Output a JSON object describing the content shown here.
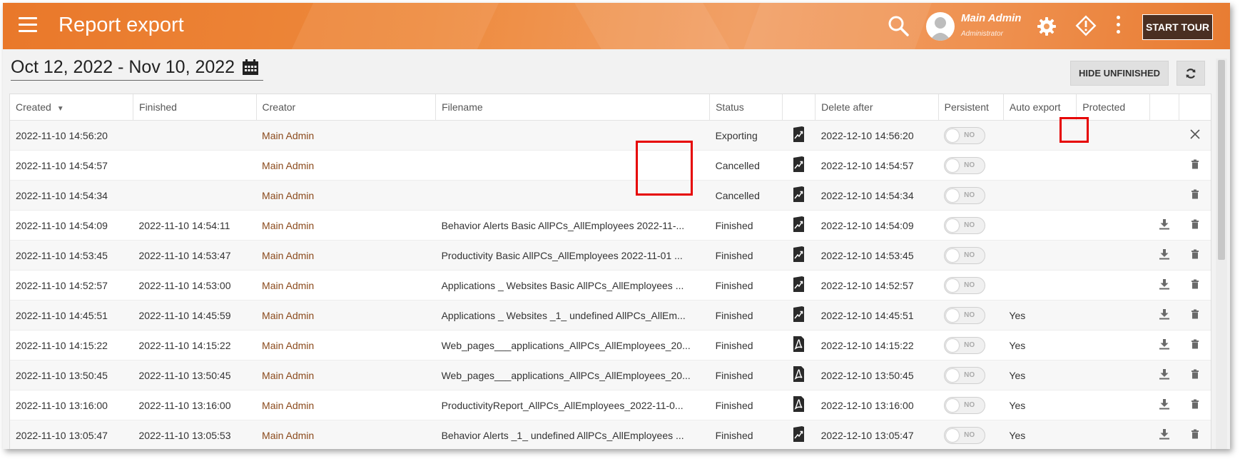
{
  "header": {
    "title": "Report export",
    "user_name": "Main Admin",
    "user_role": "Administrator",
    "start_tour_label": "START TOUR"
  },
  "toolbar": {
    "date_range": "Oct 12, 2022 - Nov 10, 2022",
    "hide_unfinished_label": "HIDE UNFINISHED"
  },
  "table": {
    "columns": [
      "Created",
      "Finished",
      "Creator",
      "Filename",
      "Status",
      "",
      "Delete after",
      "Persistent",
      "Auto export",
      "Protected",
      "",
      ""
    ],
    "toggle_label": "NO",
    "rows": [
      {
        "created": "2022-11-10 14:56:20",
        "finished": "",
        "creator": "Main Admin",
        "filename": "",
        "status": "Exporting",
        "filetype": "chart-icon",
        "delete_after": "2022-12-10 14:56:20",
        "auto_export": "",
        "action": "close-icon"
      },
      {
        "created": "2022-11-10 14:54:57",
        "finished": "",
        "creator": "Main Admin",
        "filename": "",
        "status": "Cancelled",
        "filetype": "chart-icon",
        "delete_after": "2022-12-10 14:54:57",
        "auto_export": "",
        "action": "trash-icon"
      },
      {
        "created": "2022-11-10 14:54:34",
        "finished": "",
        "creator": "Main Admin",
        "filename": "",
        "status": "Cancelled",
        "filetype": "chart-icon",
        "delete_after": "2022-12-10 14:54:34",
        "auto_export": "",
        "action": "trash-icon"
      },
      {
        "created": "2022-11-10 14:54:09",
        "finished": "2022-11-10 14:54:11",
        "creator": "Main Admin",
        "filename": "Behavior Alerts Basic AllPCs_AllEmployees 2022-11-...",
        "status": "Finished",
        "filetype": "chart-icon",
        "delete_after": "2022-12-10 14:54:09",
        "auto_export": "",
        "action": "trash-icon"
      },
      {
        "created": "2022-11-10 14:53:45",
        "finished": "2022-11-10 14:53:47",
        "creator": "Main Admin",
        "filename": "Productivity Basic AllPCs_AllEmployees 2022-11-01 ...",
        "status": "Finished",
        "filetype": "chart-icon",
        "delete_after": "2022-12-10 14:53:45",
        "auto_export": "",
        "action": "trash-icon"
      },
      {
        "created": "2022-11-10 14:52:57",
        "finished": "2022-11-10 14:53:00",
        "creator": "Main Admin",
        "filename": "Applications _ Websites Basic AllPCs_AllEmployees ...",
        "status": "Finished",
        "filetype": "chart-icon",
        "delete_after": "2022-12-10 14:52:57",
        "auto_export": "",
        "action": "trash-icon"
      },
      {
        "created": "2022-11-10 14:45:51",
        "finished": "2022-11-10 14:45:59",
        "creator": "Main Admin",
        "filename": "Applications _ Websites _1_ undefined AllPCs_AllEm...",
        "status": "Finished",
        "filetype": "chart-icon",
        "delete_after": "2022-12-10 14:45:51",
        "auto_export": "Yes",
        "action": "trash-icon"
      },
      {
        "created": "2022-11-10 14:15:22",
        "finished": "2022-11-10 14:15:22",
        "creator": "Main Admin",
        "filename": "Web_pages___applications_AllPCs_AllEmployees_20...",
        "status": "Finished",
        "filetype": "pdf-icon",
        "delete_after": "2022-12-10 14:15:22",
        "auto_export": "Yes",
        "action": "trash-icon"
      },
      {
        "created": "2022-11-10 13:50:45",
        "finished": "2022-11-10 13:50:45",
        "creator": "Main Admin",
        "filename": "Web_pages___applications_AllPCs_AllEmployees_20...",
        "status": "Finished",
        "filetype": "pdf-icon",
        "delete_after": "2022-12-10 13:50:45",
        "auto_export": "Yes",
        "action": "trash-icon"
      },
      {
        "created": "2022-11-10 13:16:00",
        "finished": "2022-11-10 13:16:00",
        "creator": "Main Admin",
        "filename": "ProductivityReport_AllPCs_AllEmployees_2022-11-0...",
        "status": "Finished",
        "filetype": "pdf-icon",
        "delete_after": "2022-12-10 13:16:00",
        "auto_export": "Yes",
        "action": "trash-icon"
      },
      {
        "created": "2022-11-10 13:05:47",
        "finished": "2022-11-10 13:05:53",
        "creator": "Main Admin",
        "filename": "Behavior Alerts _1_ undefined AllPCs_AllEmployees ...",
        "status": "Finished",
        "filetype": "chart-icon",
        "delete_after": "2022-12-10 13:05:47",
        "auto_export": "Yes",
        "action": "trash-icon"
      }
    ]
  },
  "colors": {
    "header_orange": "#ea7d2f",
    "creator_link": "#8b4a1c",
    "highlight_red": "#e60000",
    "tour_button_bg": "#4a2f22"
  }
}
